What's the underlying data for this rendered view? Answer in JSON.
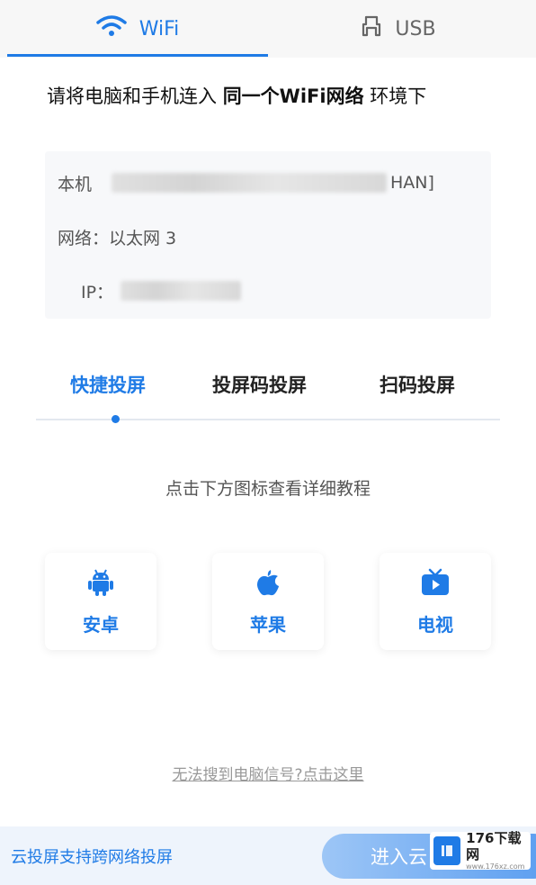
{
  "connection_tabs": {
    "wifi_label": "WiFi",
    "usb_label": "USB",
    "active": "WiFi"
  },
  "instruction": {
    "prefix": "请将电脑和手机连入 ",
    "emphasis": "同一个WiFi网络",
    "suffix": " 环境下"
  },
  "info": {
    "host_label": "本机",
    "host_value_visible": "HAN]",
    "network_label": "网络：",
    "network_value": "以太网 3",
    "ip_label": "IP："
  },
  "mode_tabs": {
    "items": [
      "快捷投屏",
      "投屏码投屏",
      "扫码投屏"
    ],
    "active_index": 0
  },
  "hint": "点击下方图标查看详细教程",
  "devices": [
    {
      "label": "安卓",
      "icon": "android-icon"
    },
    {
      "label": "苹果",
      "icon": "apple-icon"
    },
    {
      "label": "电视",
      "icon": "tv-icon"
    }
  ],
  "help_link": "无法搜到电脑信号?点击这里",
  "bottom_bar": {
    "text": "云投屏支持跨网络投屏",
    "button_label": "进入云"
  },
  "watermark": {
    "title": "176下载网",
    "subtitle": "www.176xz.com"
  },
  "colors": {
    "accent": "#1f7be6",
    "card_bg": "#f7f8fa",
    "bottom_bg": "#eef4fc"
  }
}
